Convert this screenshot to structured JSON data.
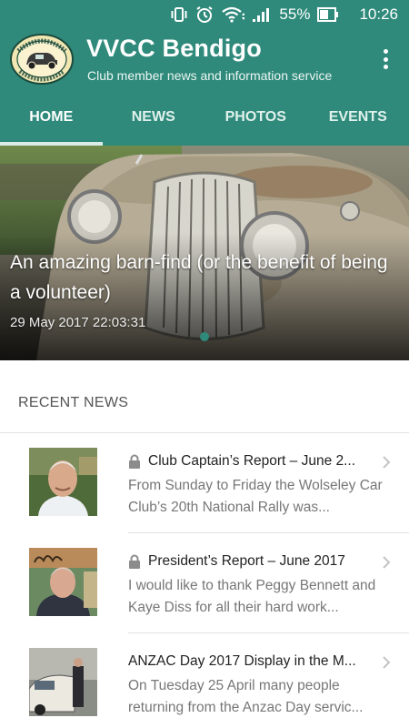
{
  "status_bar": {
    "battery": "55%",
    "time": "10:26",
    "icons": [
      "vibrate-icon",
      "alarm-icon",
      "wifi-icon",
      "signal-icon",
      "battery-icon"
    ]
  },
  "app_bar": {
    "title": "VVCC Bendigo",
    "subtitle": "Club member news and information service",
    "logo_text_top": "VETERAN, VINTAGE & CLASSIC CLUB",
    "logo_text_bottom": "BENDIGO Inc."
  },
  "tabs": [
    {
      "label": "HOME",
      "active": true
    },
    {
      "label": "NEWS",
      "active": false
    },
    {
      "label": "PHOTOS",
      "active": false
    },
    {
      "label": "EVENTS",
      "active": false
    }
  ],
  "hero": {
    "title": "An amazing barn-find (or the benefit of being a volunteer)",
    "date": "29 May 2017 22:03:31"
  },
  "recent_news": {
    "header": "RECENT NEWS",
    "items": [
      {
        "title": "Club Captain’s Report – June 2...",
        "excerpt": "From Sunday to Friday the Wolseley Car Club’s 20th National Rally was...",
        "locked": true
      },
      {
        "title": "President’s Report – June 2017",
        "excerpt": "I would like to thank Peggy Bennett and Kaye Diss for all their hard work...",
        "locked": true
      },
      {
        "title": "ANZAC Day 2017 Display in the M...",
        "excerpt": "On Tuesday 25 April many people returning from the Anzac Day servic...",
        "locked": false
      }
    ]
  },
  "colors": {
    "primary": "#2f8a7b",
    "tab_indicator": "#d9ece6"
  }
}
